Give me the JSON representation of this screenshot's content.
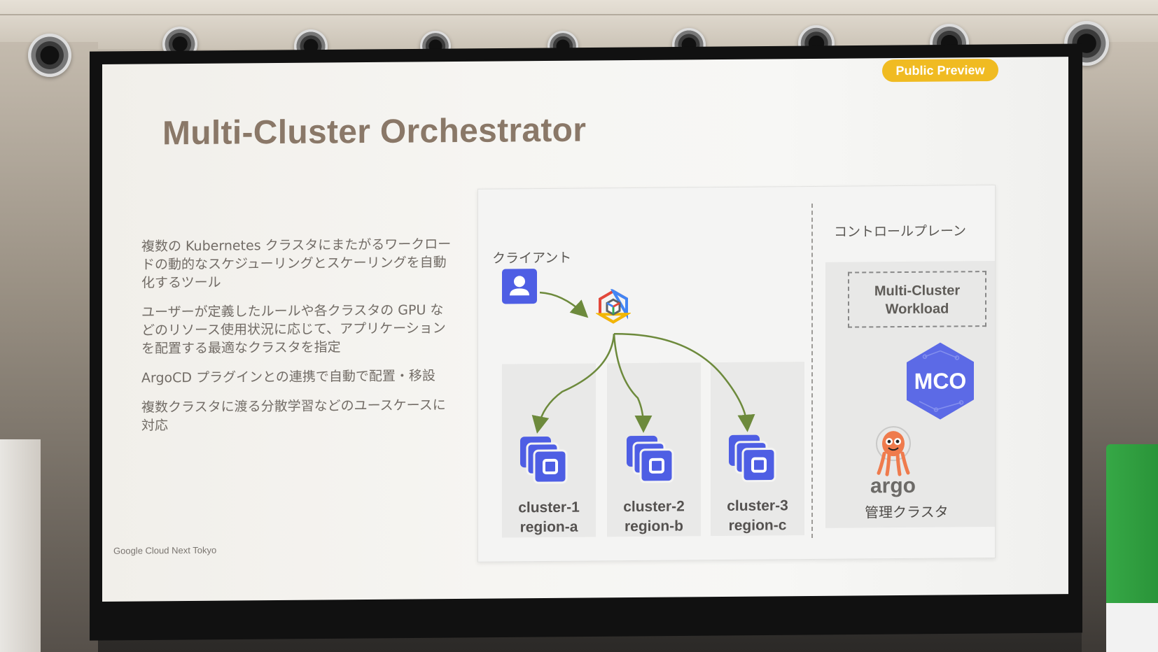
{
  "slide": {
    "badge": "Public Preview",
    "title": "Multi-Cluster Orchestrator",
    "bullets": [
      "複数の Kubernetes クラスタにまたがるワークロードの動的なスケジューリングとスケーリングを自動化するツール",
      "ユーザーが定義したルールや各クラスタの GPU などのリソース使用状況に応じて、アプリケーションを配置する最適なクラスタを指定",
      "ArgoCD プラグインとの連携で自動で配置・移設",
      "複数クラスタに渡る分散学習などのユースケースに対応"
    ],
    "footer": "Google Cloud Next Tokyo",
    "colors": {
      "badge": "#f0bb22",
      "title": "#8a7868",
      "icon_blue": "#4e5ee4",
      "arrow": "#6d8a3c"
    }
  },
  "diagram": {
    "client_label": "クライアント",
    "control_plane_label": "コントロールプレーン",
    "workload_box": "Multi-Cluster Workload",
    "mco_label": "MCO",
    "argo_label": "argo",
    "management_cluster_label": "管理クラスタ",
    "clusters": [
      {
        "name": "cluster-1",
        "region": "region-a"
      },
      {
        "name": "cluster-2",
        "region": "region-b"
      },
      {
        "name": "cluster-3",
        "region": "region-c"
      }
    ],
    "icons": [
      "user-icon",
      "hub-icon",
      "cluster-icon",
      "mco-hexagon-icon",
      "argo-octopus-icon"
    ]
  }
}
